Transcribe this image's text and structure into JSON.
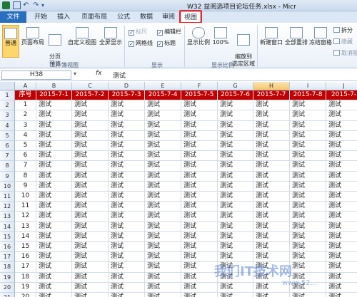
{
  "window": {
    "title": "W32 益阅选项目论坛任务.xlsx - Micr"
  },
  "tabs": [
    {
      "label": "文件",
      "key": "file"
    },
    {
      "label": "开始",
      "key": "home"
    },
    {
      "label": "插入",
      "key": "insert"
    },
    {
      "label": "页面布局",
      "key": "layout"
    },
    {
      "label": "公式",
      "key": "formulas"
    },
    {
      "label": "数据",
      "key": "data"
    },
    {
      "label": "审阅",
      "key": "review"
    },
    {
      "label": "视图",
      "key": "view"
    }
  ],
  "ribbon": {
    "workbook_views": {
      "group_label": "工作簿视图",
      "normal": "普通",
      "page_layout": "页面布局",
      "page_break": "分页\n预览",
      "custom_views": "自定义视图",
      "full_screen": "全屏显示"
    },
    "show": {
      "group_label": "显示",
      "ruler": "标尺",
      "formula_bar": "编辑栏",
      "gridlines": "网格线",
      "headings": "标题"
    },
    "zoom": {
      "group_label": "显示比例",
      "zoom": "显示比例",
      "hundred": "100%",
      "zoom_to_selection": "缩放到\n选定区域"
    },
    "window": {
      "new_window": "新建窗口",
      "arrange_all": "全部重排",
      "freeze_panes": "冻结窗格",
      "split": "拆分",
      "hide": "隐藏",
      "unhide": "取消隐藏"
    }
  },
  "formula_bar": {
    "name_box": "H38",
    "fx": "fx",
    "content": "测试"
  },
  "sheet": {
    "columns": [
      "A",
      "B",
      "C",
      "D",
      "E",
      "F",
      "G",
      "H",
      "I",
      "J"
    ],
    "selected_column": "H",
    "header_row": [
      "序号",
      "2015-7-1",
      "2015-7-2",
      "2015-7-3",
      "2015-7-4",
      "2015-7-5",
      "2015-7-6",
      "2015-7-7",
      "2015-7-8",
      "2015-7-"
    ],
    "row_numbers": [
      "1",
      "2",
      "3",
      "4",
      "5",
      "6",
      "7",
      "8",
      "9",
      "10",
      "11",
      "12",
      "13",
      "14",
      "15",
      "16",
      "17",
      "18",
      "19",
      "20",
      "21"
    ],
    "seq_values": [
      "1",
      "2",
      "3",
      "4",
      "5",
      "6",
      "7",
      "8",
      "9",
      "10",
      "11",
      "12",
      "13",
      "14",
      "15",
      "16",
      "17",
      "18",
      "19",
      "20"
    ],
    "cell_text": "测试"
  },
  "watermark": {
    "text": "我们IT技术网",
    "url": "www.52..."
  },
  "colors": {
    "header_fill": "#c00000",
    "file_tab": "#2a6ebf",
    "view_highlight": "#e22222"
  }
}
